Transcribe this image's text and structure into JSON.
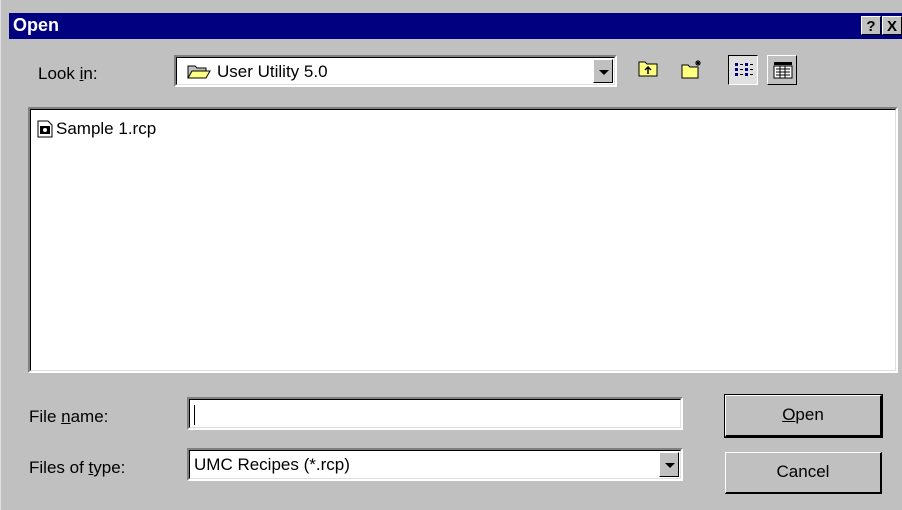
{
  "window": {
    "title": "Open",
    "help_label": "?",
    "close_label": "X"
  },
  "look_in": {
    "label_pre": "Look ",
    "label_accel": "i",
    "label_post": "n:",
    "value": "User Utility 5.0",
    "icon": "folder-open-icon"
  },
  "toolbar": {
    "buttons": [
      {
        "name": "up-one-level",
        "icon": "folder-up-icon"
      },
      {
        "name": "create-new-folder",
        "icon": "new-folder-icon"
      },
      {
        "name": "list-view",
        "icon": "list-view-icon",
        "pressed": true
      },
      {
        "name": "details-view",
        "icon": "details-view-icon",
        "pressed": false
      }
    ]
  },
  "files": [
    {
      "name": "Sample 1.rcp",
      "icon": "recipe-file-icon"
    }
  ],
  "file_name": {
    "label_pre": "File ",
    "label_accel": "n",
    "label_post": "ame:",
    "value": ""
  },
  "file_type": {
    "label_pre": "Files of ",
    "label_accel": "t",
    "label_post": "ype:",
    "value": "UMC Recipes (*.rcp)"
  },
  "buttons": {
    "open_accel": "O",
    "open_rest": "pen",
    "cancel": "Cancel"
  }
}
